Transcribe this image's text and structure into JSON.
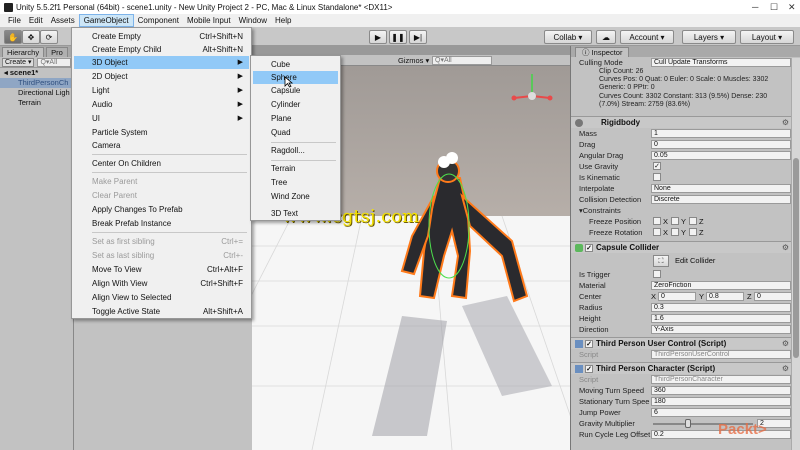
{
  "window": {
    "title": "Unity 5.5.2f1 Personal (64bit) - scene1.unity - New Unity Project 2 - PC, Mac & Linux Standalone* <DX11>"
  },
  "menubar": [
    "File",
    "Edit",
    "Assets",
    "GameObject",
    "Component",
    "Mobile Input",
    "Window",
    "Help"
  ],
  "toolbar": {
    "collab": "Collab ▾",
    "account": "Account",
    "layers": "Layers",
    "layout": "Layout"
  },
  "hierarchy": {
    "tabs": [
      "Hierarchy",
      "Pro"
    ],
    "create": "Create ▾",
    "search": "Q▾All",
    "scene": "scene1*",
    "items": [
      "ThirdPersonCh",
      "Directional Ligh",
      "Terrain"
    ]
  },
  "gameobject_menu": {
    "items": [
      {
        "label": "Create Empty",
        "shortcut": "Ctrl+Shift+N"
      },
      {
        "label": "Create Empty Child",
        "shortcut": "Alt+Shift+N"
      },
      {
        "label": "3D Object",
        "shortcut": ""
      },
      {
        "label": "2D Object",
        "shortcut": ""
      },
      {
        "label": "Light",
        "shortcut": ""
      },
      {
        "label": "Audio",
        "shortcut": ""
      },
      {
        "label": "UI",
        "shortcut": ""
      },
      {
        "label": "Particle System",
        "shortcut": ""
      },
      {
        "label": "Camera",
        "shortcut": ""
      },
      {
        "label": "Center On Children",
        "shortcut": ""
      },
      {
        "label": "Make Parent",
        "shortcut": ""
      },
      {
        "label": "Clear Parent",
        "shortcut": ""
      },
      {
        "label": "Apply Changes To Prefab",
        "shortcut": ""
      },
      {
        "label": "Break Prefab Instance",
        "shortcut": ""
      },
      {
        "label": "Set as first sibling",
        "shortcut": "Ctrl+="
      },
      {
        "label": "Set as last sibling",
        "shortcut": "Ctrl+-"
      },
      {
        "label": "Move To View",
        "shortcut": "Ctrl+Alt+F"
      },
      {
        "label": "Align With View",
        "shortcut": "Ctrl+Shift+F"
      },
      {
        "label": "Align View to Selected",
        "shortcut": ""
      },
      {
        "label": "Toggle Active State",
        "shortcut": "Alt+Shift+A"
      }
    ]
  },
  "object3d_menu": {
    "items": [
      "Cube",
      "Sphere",
      "Capsule",
      "Cylinder",
      "Plane",
      "Quad",
      "Ragdoll...",
      "Terrain",
      "Tree",
      "Wind Zone",
      "3D Text"
    ]
  },
  "scene": {
    "gizmos": "Gizmos ▾",
    "search": "Q▾All"
  },
  "inspector": {
    "tab": "Inspector",
    "culling": {
      "label": "Culling Mode",
      "value": "Cull Update Transforms"
    },
    "stats": [
      "Clip Count: 26",
      "Curves Pos: 0 Quat: 0 Euler: 0 Scale: 0 Muscles: 3302",
      "Generic: 0 PPtr: 0",
      "Curves Count: 3302 Constant: 313 (9.5%) Dense: 230",
      "(7.0%) Stream: 2759 (83.6%)"
    ],
    "rigidbody": {
      "title": "Rigidbody",
      "mass": {
        "label": "Mass",
        "value": "1"
      },
      "drag": {
        "label": "Drag",
        "value": "0"
      },
      "angular_drag": {
        "label": "Angular Drag",
        "value": "0.05"
      },
      "use_gravity": {
        "label": "Use Gravity",
        "value": "✓"
      },
      "is_kinematic": {
        "label": "Is Kinematic",
        "value": ""
      },
      "interpolate": {
        "label": "Interpolate",
        "value": "None"
      },
      "collision": {
        "label": "Collision Detection",
        "value": "Discrete"
      },
      "constraints": "Constraints",
      "freeze_position": "Freeze Position",
      "freeze_rotation": "Freeze Rotation",
      "axes": [
        "X",
        "Y",
        "Z"
      ]
    },
    "capsule": {
      "title": "Capsule Collider",
      "edit": "Edit Collider",
      "is_trigger": {
        "label": "Is Trigger",
        "value": ""
      },
      "material": {
        "label": "Material",
        "value": "ZeroFriction"
      },
      "center": {
        "label": "Center",
        "x": "0",
        "y": "0.8",
        "z": "0"
      },
      "radius": {
        "label": "Radius",
        "value": "0.3"
      },
      "height": {
        "label": "Height",
        "value": "1.6"
      },
      "direction": {
        "label": "Direction",
        "value": "Y-Axis"
      }
    },
    "user_control": {
      "title": "Third Person User Control (Script)",
      "script": {
        "label": "Script",
        "value": "ThirdPersonUserControl"
      }
    },
    "character": {
      "title": "Third Person Character (Script)",
      "script": {
        "label": "Script",
        "value": "ThirdPersonCharacter"
      },
      "moving_turn": {
        "label": "Moving Turn Speed",
        "value": "360"
      },
      "stationary_turn": {
        "label": "Stationary Turn Spee",
        "value": "180"
      },
      "jump_power": {
        "label": "Jump Power",
        "value": "6"
      },
      "gravity_mult": {
        "label": "Gravity Multiplier",
        "value": "2"
      },
      "run_cycle": {
        "label": "Run Cycle Leg Offset",
        "value": "0.2"
      }
    }
  },
  "watermark": "www.cgtsj.com",
  "brand": "Packt>"
}
